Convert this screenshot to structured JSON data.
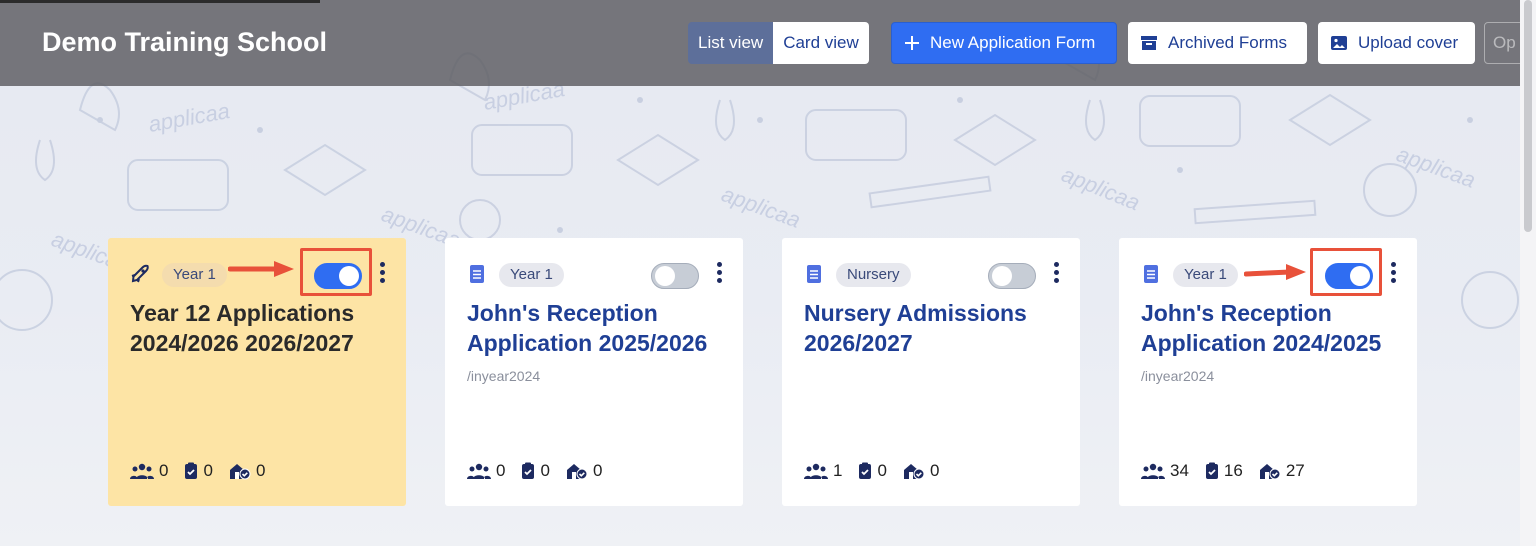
{
  "header": {
    "school_name": "Demo Training School",
    "view_toggle": {
      "list_label": "List view",
      "card_label": "Card view",
      "active": "list"
    },
    "new_form_label": "New Application Form",
    "archived_label": "Archived Forms",
    "upload_cover_label": "Upload cover",
    "partial_button_label": "Op"
  },
  "cards": [
    {
      "type_icon": "rocket-icon",
      "badge": "Year 1",
      "enabled": true,
      "highlighted": true,
      "title": "Year 12 Applications 2024/2026 2026/2027",
      "slug": "",
      "stats": {
        "applicants": "0",
        "submitted": "0",
        "offers": "0"
      }
    },
    {
      "type_icon": "document-icon",
      "badge": "Year 1",
      "enabled": false,
      "highlighted": false,
      "title": "John's Reception Application 2025/2026",
      "slug": "/inyear2024",
      "stats": {
        "applicants": "0",
        "submitted": "0",
        "offers": "0"
      }
    },
    {
      "type_icon": "document-icon",
      "badge": "Nursery",
      "enabled": false,
      "highlighted": false,
      "title": "Nursery Admissions 2026/2027",
      "slug": "",
      "stats": {
        "applicants": "1",
        "submitted": "0",
        "offers": "0"
      }
    },
    {
      "type_icon": "document-icon",
      "badge": "Year 1",
      "enabled": true,
      "highlighted": false,
      "title": "John's Reception Application 2024/2025",
      "slug": "/inyear2024",
      "stats": {
        "applicants": "34",
        "submitted": "16",
        "offers": "27"
      }
    }
  ],
  "colors": {
    "primary": "#2f6df2",
    "title_blue": "#1f3f95",
    "highlight_card": "#fde4a5",
    "callout_red": "#e8513a"
  }
}
